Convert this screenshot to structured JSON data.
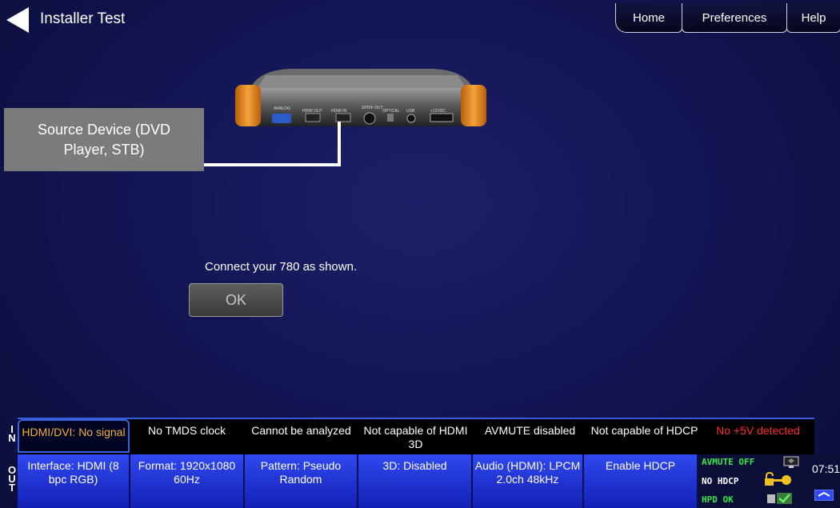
{
  "header": {
    "title": "Installer Test",
    "tabs": [
      {
        "label": "Home"
      },
      {
        "label": "Preferences"
      },
      {
        "label": "Help"
      }
    ]
  },
  "diagram": {
    "source_label": "Source Device (DVD Player, STB)",
    "device_ports": [
      "ANALOG",
      "HDMI OUT",
      "HDMI IN",
      "SPDIF OUT",
      "OPTICAL",
      "USB",
      "+12VDC"
    ]
  },
  "dialog": {
    "message": "Connect your 780 as shown.",
    "ok_label": "OK"
  },
  "in_row": {
    "tag": [
      "I",
      "N"
    ],
    "cells": [
      "HDMI/DVI: No signal",
      "No TMDS clock",
      "Cannot be analyzed",
      "Not capable of HDMI 3D",
      "AVMUTE disabled",
      "Not capable of HDCP",
      "No +5V detected"
    ]
  },
  "out_row": {
    "tag": [
      "O",
      "U",
      "T"
    ],
    "cells": [
      "Interface: HDMI (8 bpc RGB)",
      "Format: 1920x1080 60Hz",
      "Pattern: Pseudo Random",
      "3D: Disabled",
      "Audio (HDMI): LPCM 2.0ch 48kHz",
      "Enable HDCP"
    ],
    "status": {
      "avmute": "AVMUTE OFF",
      "hdcp": "NO HDCP",
      "hpd": "HPD OK"
    },
    "clock": "07:51"
  },
  "colors": {
    "background": "#131654",
    "in_selected_text": "#f3b13a",
    "in_warning_text": "#ff2a2a",
    "out_button": "#2f49f0",
    "status_green": "#38e64a",
    "device_orange": "#e8871c"
  }
}
